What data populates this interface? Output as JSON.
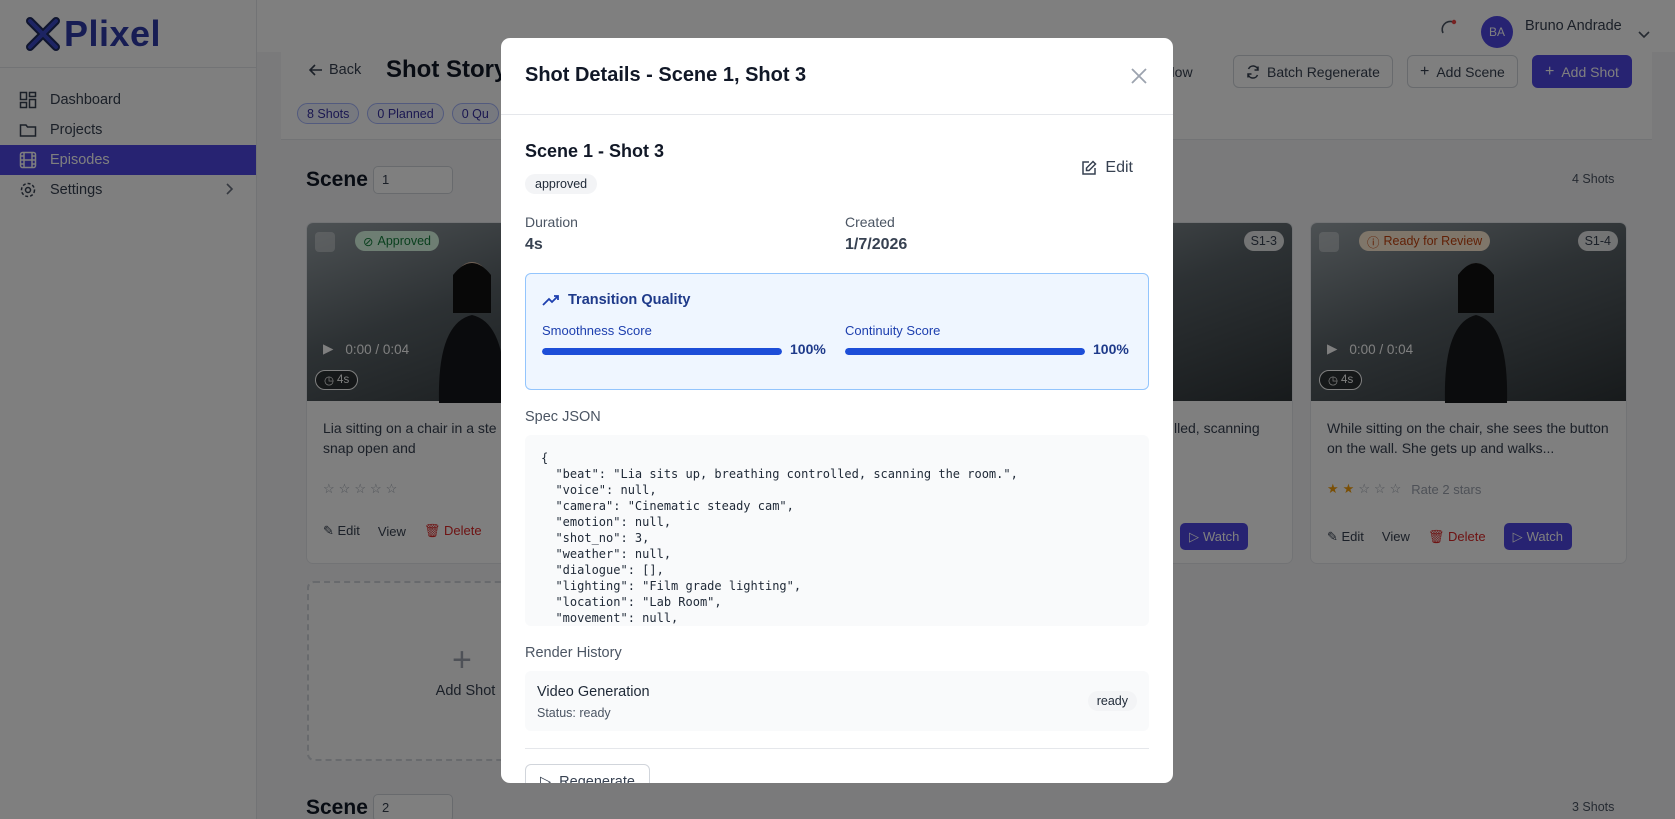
{
  "brand": {
    "name": "Plixel",
    "accent": "#4f46e5"
  },
  "sidebar": {
    "items": [
      {
        "label": "Dashboard",
        "icon": "dashboard-icon"
      },
      {
        "label": "Projects",
        "icon": "folder-icon"
      },
      {
        "label": "Episodes",
        "icon": "film-icon",
        "active": true
      },
      {
        "label": "Settings",
        "icon": "gear-icon"
      }
    ]
  },
  "user": {
    "initials": "BA",
    "name": "Bruno Andrade"
  },
  "header": {
    "back_label": "Back",
    "title": "Shot Story",
    "flow_label": "Flow",
    "batch_label": "Batch Regenerate",
    "add_scene_label": "Add Scene",
    "add_shot_label": "Add Shot",
    "pills": [
      "8 Shots",
      "0 Planned",
      "0 Qu"
    ]
  },
  "scenes": [
    {
      "label": "Scene",
      "number": "1",
      "count": "4 Shots"
    },
    {
      "label": "Scene",
      "number": "2",
      "count": "3 Shots"
    }
  ],
  "cards": [
    {
      "badge": "Approved",
      "time": "0:00 / 0:04",
      "duration": "4s",
      "desc": "Lia sitting on a chair in a ste lab. Her eyes snap open and",
      "rating_label": "",
      "edit": "Edit",
      "view": "View",
      "delete": "Delete"
    },
    {
      "badge": "Ready for Review",
      "id": "S1-4",
      "time": "0:00 / 0:04",
      "duration": "4s",
      "desc": "While sitting on the chair, she sees the button on the wall. She gets up and walks...",
      "rating_label": "Rate 2 stars",
      "edit": "Edit",
      "view": "View",
      "delete": "Delete",
      "watch": "Watch"
    }
  ],
  "partial_card": {
    "id": "S1-3",
    "desc": "lled, scanning",
    "watch": "Watch"
  },
  "add_shot_tile": {
    "label": "Add Shot"
  },
  "modal": {
    "title": "Shot Details - Scene 1, Shot 3",
    "heading": "Scene 1 - Shot 3",
    "status": "approved",
    "edit_label": "Edit",
    "duration_label": "Duration",
    "duration_value": "4s",
    "created_label": "Created",
    "created_value": "1/7/2026",
    "transition": {
      "title": "Transition Quality",
      "smoothness_label": "Smoothness Score",
      "smoothness_pct": "100%",
      "smoothness_value": 1.0,
      "continuity_label": "Continuity Score",
      "continuity_pct": "100%",
      "continuity_value": 1.0
    },
    "spec_label": "Spec JSON",
    "spec_json": "{\n  \"beat\": \"Lia sits up, breathing controlled, scanning the room.\",\n  \"voice\": null,\n  \"camera\": \"Cinematic steady cam\",\n  \"emotion\": null,\n  \"shot_no\": 3,\n  \"weather\": null,\n  \"dialogue\": [],\n  \"lighting\": \"Film grade lighting\",\n  \"location\": \"Lab Room\",\n  \"movement\": null,",
    "render_history_label": "Render History",
    "render": {
      "title": "Video Generation",
      "status": "Status: ready",
      "chip": "ready"
    },
    "regenerate_label": "Regenerate"
  }
}
